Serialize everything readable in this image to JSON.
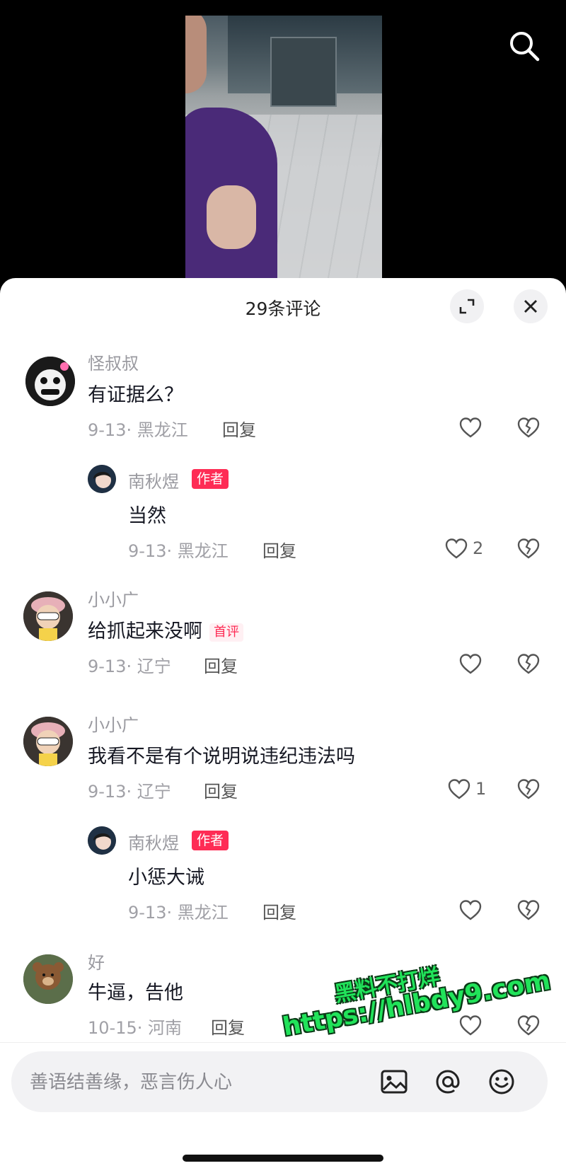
{
  "header": {
    "title": "29条评论"
  },
  "comments": [
    {
      "name": "怪叔叔",
      "text": "有证据么？",
      "date": "9-13",
      "location": "黑龙江",
      "reply_label": "回复",
      "likes": ""
    },
    {
      "name": "南秋煜",
      "badge": "作者",
      "text": "当然",
      "date": "9-13",
      "location": "黑龙江",
      "reply_label": "回复",
      "likes": "2"
    },
    {
      "name": "小小广",
      "text": "给抓起来没啊",
      "first_badge": "首评",
      "date": "9-13",
      "location": "辽宁",
      "reply_label": "回复",
      "likes": ""
    },
    {
      "name": "小小广",
      "text": "我看不是有个说明说违纪违法吗",
      "date": "9-13",
      "location": "辽宁",
      "reply_label": "回复",
      "likes": "1"
    },
    {
      "name": "南秋煜",
      "badge": "作者",
      "text": "小惩大诫",
      "date": "9-13",
      "location": "黑龙江",
      "reply_label": "回复",
      "likes": ""
    },
    {
      "name": "好",
      "text": "牛逼，告他",
      "date": "10-15",
      "location": "河南",
      "reply_label": "回复",
      "likes": ""
    }
  ],
  "input": {
    "placeholder": "善语结善缘，恶言伤人心"
  },
  "watermark": {
    "line1": "黑料不打烊",
    "line2": "https://hlbdy9.com"
  },
  "icons": {
    "search": "search-icon",
    "expand": "expand-icon",
    "close": "close-icon",
    "like": "heart-outline-icon",
    "dislike": "broken-heart-icon",
    "image": "image-icon",
    "mention": "at-icon",
    "emoji": "smiley-icon"
  },
  "colors": {
    "accent": "#fe2c55",
    "background": "#ffffff",
    "video_bg": "#000000"
  }
}
